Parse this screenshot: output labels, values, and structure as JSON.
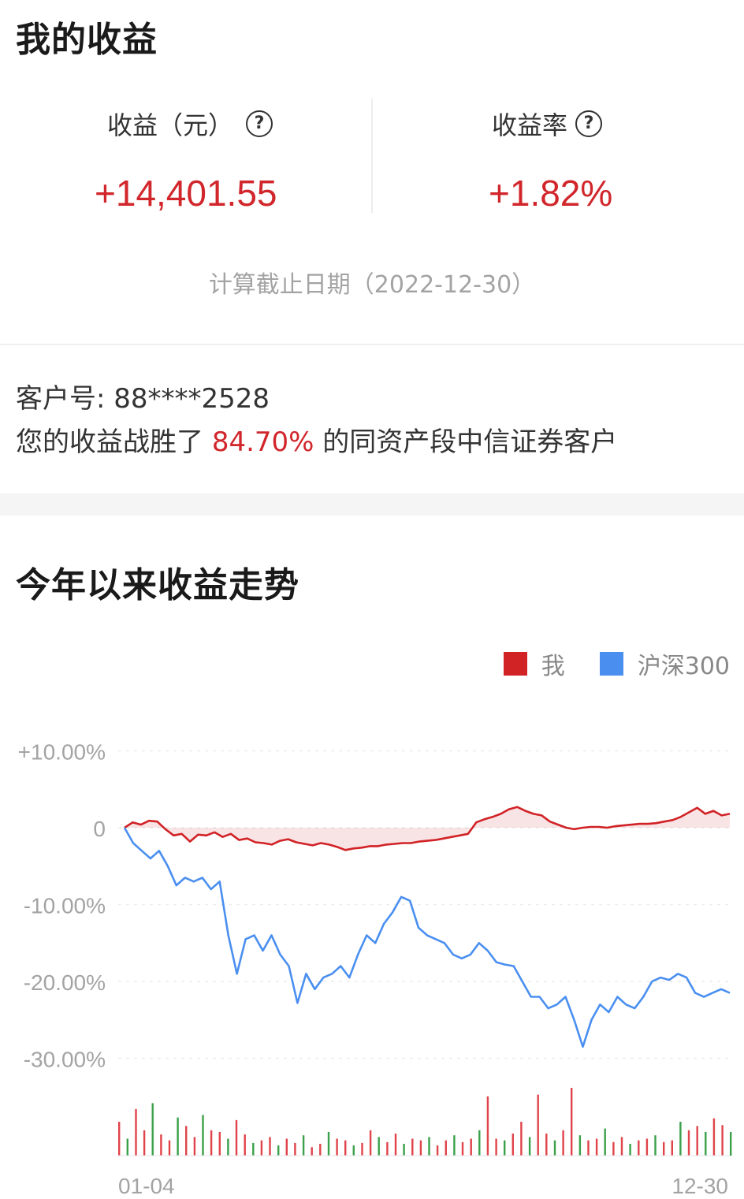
{
  "header": {
    "title": "我的收益"
  },
  "metrics": {
    "profit": {
      "label": "收益（元）",
      "value": "+14,401.55",
      "help": "?"
    },
    "rate": {
      "label": "收益率",
      "value": "+1.82%",
      "help": "?"
    }
  },
  "date_note": "计算截止日期（2022-12-30）",
  "client": {
    "label": "客户号: 88****2528"
  },
  "beat": {
    "prefix": "您的收益战胜了 ",
    "percent": "84.70%",
    "suffix": " 的同资产段中信证券客户"
  },
  "section": {
    "title": "今年以来收益走势"
  },
  "colors": {
    "mine": "#d12226",
    "index": "#4a8ff0",
    "accent": "#d1262b"
  },
  "chart_data": {
    "type": "line",
    "legend": [
      "我",
      "沪深300"
    ],
    "legend_position": "top-right",
    "y_tick_labels": [
      "+10.00%",
      "0",
      "-10.00%",
      "-20.00%",
      "-30.00%"
    ],
    "y_ticks": [
      10,
      0,
      -10,
      -20,
      -30
    ],
    "ylim": [
      -30,
      10
    ],
    "x_tick_labels": [
      "01-04",
      "12-30"
    ],
    "grid": true,
    "series": [
      {
        "name": "我",
        "color": "#d12226",
        "fill": true,
        "values": [
          0.0,
          0.7,
          0.4,
          0.9,
          0.8,
          -0.2,
          -1.0,
          -0.8,
          -1.8,
          -0.9,
          -1.0,
          -0.6,
          -1.2,
          -0.8,
          -1.6,
          -1.4,
          -1.9,
          -2.0,
          -2.2,
          -1.7,
          -1.5,
          -1.9,
          -2.1,
          -2.3,
          -2.0,
          -2.2,
          -2.5,
          -2.9,
          -2.7,
          -2.6,
          -2.4,
          -2.4,
          -2.2,
          -2.1,
          -2.0,
          -2.0,
          -1.8,
          -1.7,
          -1.6,
          -1.4,
          -1.2,
          -1.0,
          -0.8,
          0.7,
          1.1,
          1.4,
          1.8,
          2.4,
          2.7,
          2.2,
          1.8,
          1.6,
          0.8,
          0.4,
          0.0,
          -0.2,
          0.0,
          0.1,
          0.1,
          0.0,
          0.2,
          0.3,
          0.4,
          0.5,
          0.5,
          0.6,
          0.8,
          1.0,
          1.4,
          2.0,
          2.6,
          1.8,
          2.2,
          1.6,
          1.8
        ]
      },
      {
        "name": "沪深300",
        "color": "#4a8ff0",
        "fill": false,
        "values": [
          0.0,
          -2.0,
          -3.0,
          -4.0,
          -3.0,
          -5.0,
          -7.5,
          -6.5,
          -7.0,
          -6.5,
          -8.0,
          -7.0,
          -14.0,
          -19.0,
          -14.5,
          -14.0,
          -16.0,
          -14.0,
          -16.5,
          -18.0,
          -22.8,
          -19.0,
          -21.0,
          -19.5,
          -19.0,
          -18.0,
          -19.5,
          -16.5,
          -14.0,
          -15.0,
          -12.5,
          -11.0,
          -9.0,
          -9.5,
          -13.0,
          -14.0,
          -14.5,
          -15.0,
          -16.5,
          -17.0,
          -16.5,
          -15.0,
          -16.0,
          -17.5,
          -17.8,
          -18.0,
          -20.0,
          -22.0,
          -22.0,
          -23.5,
          -23.0,
          -22.0,
          -25.0,
          -28.5,
          -25.0,
          -23.0,
          -24.0,
          -22.0,
          -23.0,
          -23.5,
          -22.0,
          -20.0,
          -19.5,
          -19.8,
          -19.0,
          -19.5,
          -21.5,
          -22.0,
          -21.5,
          -21.0,
          -21.5
        ]
      },
      {
        "name": "volume",
        "type": "bar",
        "values": [
          40,
          20,
          55,
          30,
          62,
          25,
          18,
          45,
          35,
          22,
          48,
          30,
          28,
          20,
          42,
          25,
          15,
          18,
          22,
          12,
          20,
          15,
          24,
          10,
          14,
          28,
          20,
          18,
          12,
          15,
          30,
          22,
          16,
          26,
          14,
          20,
          18,
          22,
          12,
          18,
          24,
          16,
          20,
          30,
          70,
          20,
          18,
          26,
          40,
          22,
          72,
          26,
          18,
          30,
          80,
          24,
          18,
          20,
          32,
          16,
          22,
          14,
          18,
          20,
          24,
          16,
          18,
          40,
          30,
          35,
          28,
          44,
          36,
          28
        ]
      }
    ]
  }
}
